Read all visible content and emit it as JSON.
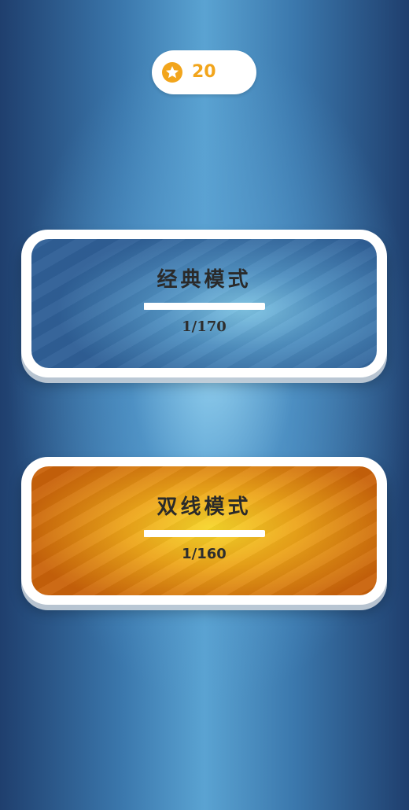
{
  "header": {
    "coins": "20",
    "coin_icon": "star-coin-icon"
  },
  "modes": [
    {
      "title": "经典模式",
      "progress_text": "1/170",
      "progress_fraction": 0.0059,
      "theme": "blue",
      "colors": {
        "center": "#7ec3e3",
        "edge": "#2f5f96"
      }
    },
    {
      "title": "双线模式",
      "progress_text": "1/160",
      "progress_fraction": 0.0063,
      "theme": "orange",
      "colors": {
        "center": "#f7d62a",
        "edge": "#c9620a"
      }
    }
  ],
  "colors": {
    "coin": "#f2a51c",
    "background": "#3b78ad"
  }
}
